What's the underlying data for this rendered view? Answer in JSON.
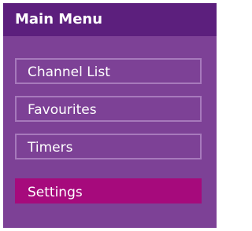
{
  "menu": {
    "title": "Main Menu",
    "items": [
      {
        "label": "Channel List",
        "selected": false
      },
      {
        "label": "Favourites",
        "selected": false
      },
      {
        "label": "Timers",
        "selected": false
      },
      {
        "label": "Settings",
        "selected": true
      }
    ]
  },
  "colors": {
    "page_background": "#ffffff",
    "panel_background": "#7d4196",
    "header_background": "#5c1f7d",
    "item_border": "#a779bc",
    "selected_item_background": "#a60a7c",
    "text": "#ffffff"
  }
}
